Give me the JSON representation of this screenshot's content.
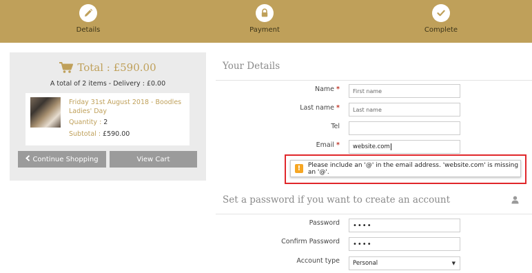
{
  "steps": [
    {
      "label": "Details",
      "icon": "pencil-icon"
    },
    {
      "label": "Payment",
      "icon": "lock-icon"
    },
    {
      "label": "Complete",
      "icon": "check-icon"
    }
  ],
  "cart": {
    "total": "Total : £590.00",
    "summary": "A total of 2 items - Delivery : £0.00",
    "item": {
      "title": "Friday 31st August 2018 - Boodles Ladies' Day",
      "quantity_label": "Quantity : ",
      "quantity_value": "2",
      "subtotal_label": "Subtotal : ",
      "subtotal_value": "£590.00"
    },
    "continue_label": "Continue Shopping",
    "view_cart_label": "View Cart"
  },
  "details": {
    "title": "Your Details",
    "name_label": "Name",
    "name_placeholder": "First name",
    "lastname_label": "Last name",
    "lastname_placeholder": "Last name",
    "tel_label": "Tel",
    "email_label": "Email",
    "email_value": "website.com",
    "required_mark": "*"
  },
  "validation": {
    "message": "Please include an '@' in the email address. 'website.com' is missing an '@'.",
    "icon": "!"
  },
  "password": {
    "title": "Set a password if you want to create an account",
    "password_label": "Password",
    "password_value": "••••",
    "confirm_label": "Confirm Password",
    "confirm_value": "••••",
    "account_type_label": "Account type",
    "account_type_value": "Personal"
  },
  "colors": {
    "brand_gold": "#bfa05a",
    "button_gray": "#9b9b9b",
    "error_red": "#e0262a",
    "warning_orange": "#f6a623"
  }
}
